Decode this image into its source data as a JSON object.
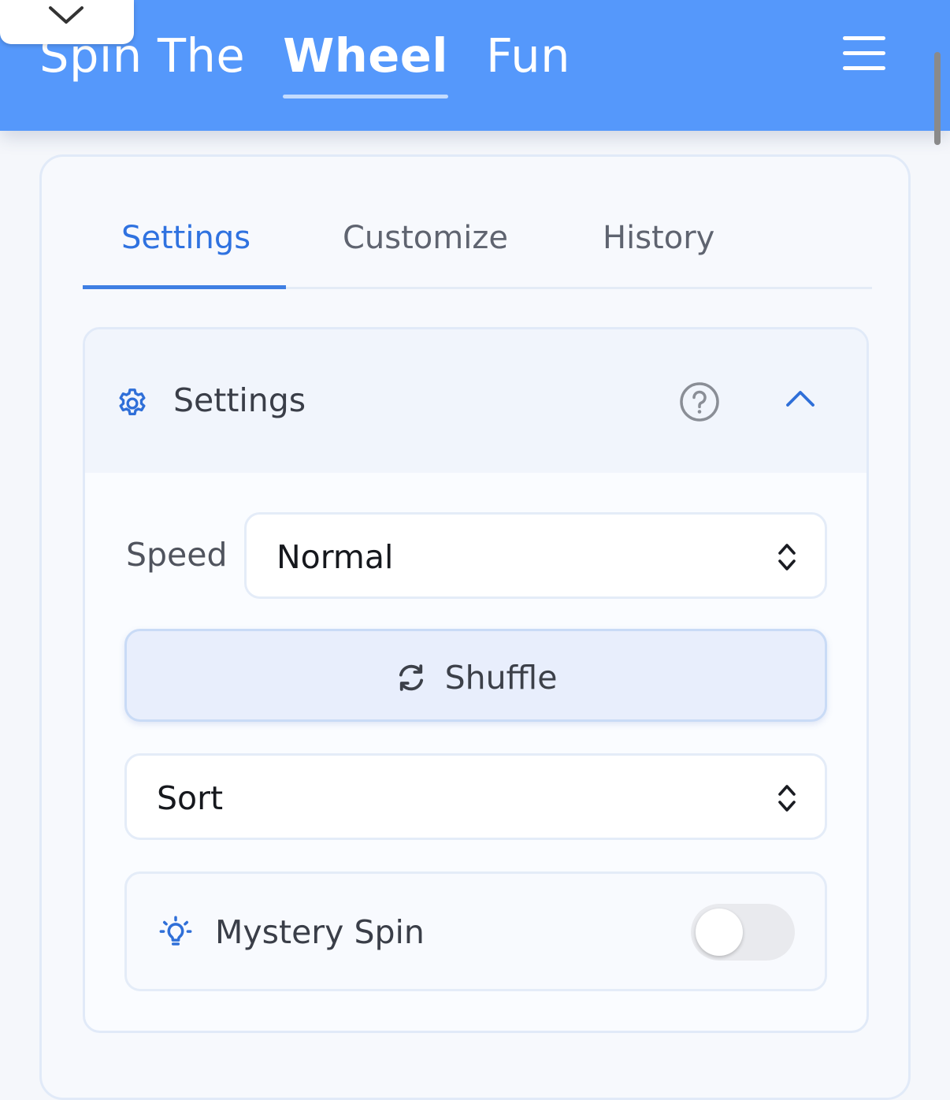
{
  "header": {
    "brand": {
      "word1": "Spin The",
      "word2": "Wheel",
      "word3": "Fun"
    },
    "menu_icon": "hamburger-menu-icon",
    "collapse_icon": "chevron-down-icon",
    "background_color": "#5598fb"
  },
  "tabs": [
    {
      "label": "Settings",
      "active": true
    },
    {
      "label": "Customize",
      "active": false
    },
    {
      "label": "History",
      "active": false
    }
  ],
  "settings_panel": {
    "title": "Settings",
    "title_icon": "gear-icon",
    "help_icon": "question-circle-icon",
    "collapse_icon": "chevron-up-icon",
    "speed": {
      "label": "Speed",
      "value": "Normal",
      "icon": "up-down-chevron-icon"
    },
    "shuffle": {
      "label": "Shuffle",
      "icon": "refresh-icon"
    },
    "sort": {
      "value": "Sort",
      "icon": "up-down-chevron-icon"
    },
    "mystery_spin": {
      "label": "Mystery Spin",
      "icon": "lightbulb-icon",
      "enabled": false
    }
  },
  "colors": {
    "accent": "#2f72e0"
  }
}
